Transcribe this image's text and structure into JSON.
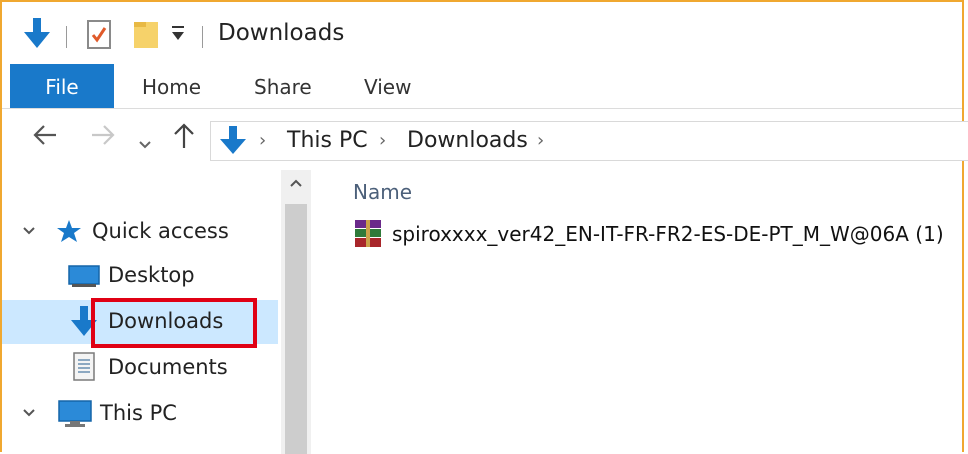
{
  "window": {
    "title": "Downloads"
  },
  "ribbon": {
    "tabs": [
      "File",
      "Home",
      "Share",
      "View"
    ]
  },
  "address": {
    "crumbs": [
      "This PC",
      "Downloads"
    ]
  },
  "navpane": {
    "quick_access": "Quick access",
    "items": [
      "Desktop",
      "Downloads",
      "Documents"
    ],
    "this_pc": "This PC"
  },
  "content": {
    "column_name": "Name",
    "files": [
      "spiroxxxx_ver42_EN-IT-FR-FR2-ES-DE-PT_M_W@06A (1)"
    ]
  },
  "colors": {
    "accent": "#1979ca",
    "selection": "#cce8ff",
    "highlight": "#e00014",
    "frame": "#f0a830"
  }
}
